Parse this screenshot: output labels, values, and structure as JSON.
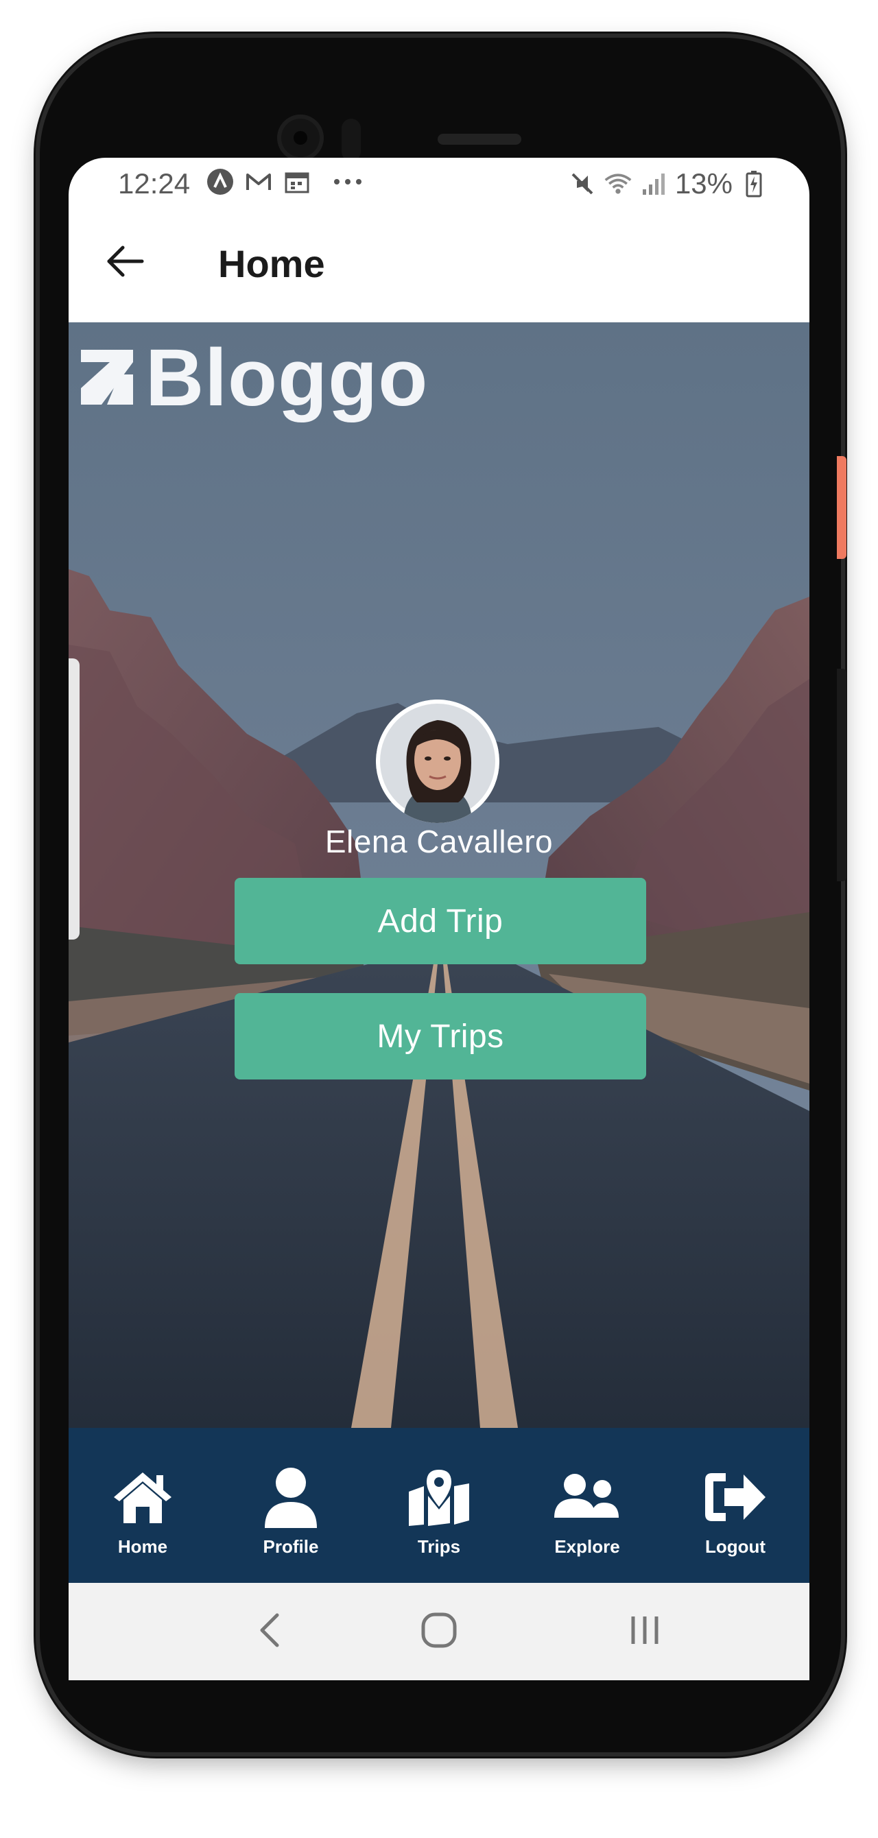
{
  "status_bar": {
    "time": "12:24",
    "left_icons": [
      "app-a-icon",
      "gmail-icon",
      "calendar-icon",
      "more-dots-icon"
    ],
    "right_icons": [
      "mute-icon",
      "wifi-icon",
      "signal-icon",
      "battery-icon"
    ],
    "battery": "13%"
  },
  "app_bar": {
    "title": "Home",
    "back_icon": "arrow-left-icon"
  },
  "hero": {
    "logo_text": "Bloggo",
    "user_name": "Elena Cavallero"
  },
  "actions": {
    "add_trip": "Add Trip",
    "my_trips": "My Trips"
  },
  "bottom_nav": {
    "items": [
      {
        "label": "Home",
        "icon": "home-icon"
      },
      {
        "label": "Profile",
        "icon": "user-icon"
      },
      {
        "label": "Trips",
        "icon": "map-pin-icon"
      },
      {
        "label": "Explore",
        "icon": "users-icon"
      },
      {
        "label": "Logout",
        "icon": "sign-out-icon"
      }
    ]
  },
  "system_nav": [
    "back-chevron-icon",
    "home-circle-icon",
    "recents-icon"
  ],
  "colors": {
    "accent_button": "#52b596",
    "bottom_nav_bg": "#133657",
    "text_dark": "#1b1b1b"
  }
}
